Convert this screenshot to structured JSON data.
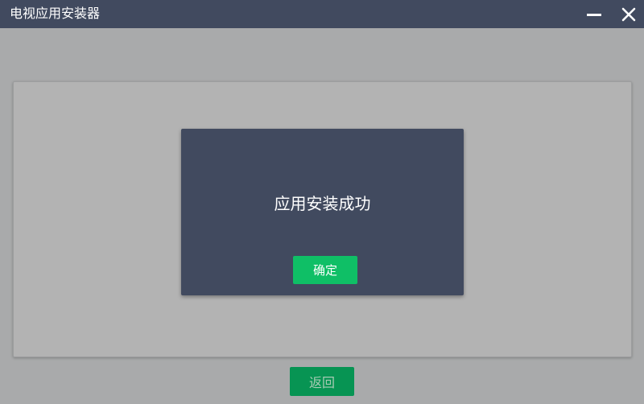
{
  "window": {
    "title": "电视应用安装器"
  },
  "titlebar": {
    "minimize_icon": "minimize-icon",
    "close_icon": "close-icon"
  },
  "dialog": {
    "message": "应用安装成功",
    "confirm_label": "确定"
  },
  "footer": {
    "back_label": "返回"
  },
  "colors": {
    "titlebar_bg": "#414a5f",
    "dialog_bg": "#414a5f",
    "confirm_green": "#0fbf66",
    "back_green_dimmed": "#079453",
    "overlay_gray": "#a9aaab"
  }
}
